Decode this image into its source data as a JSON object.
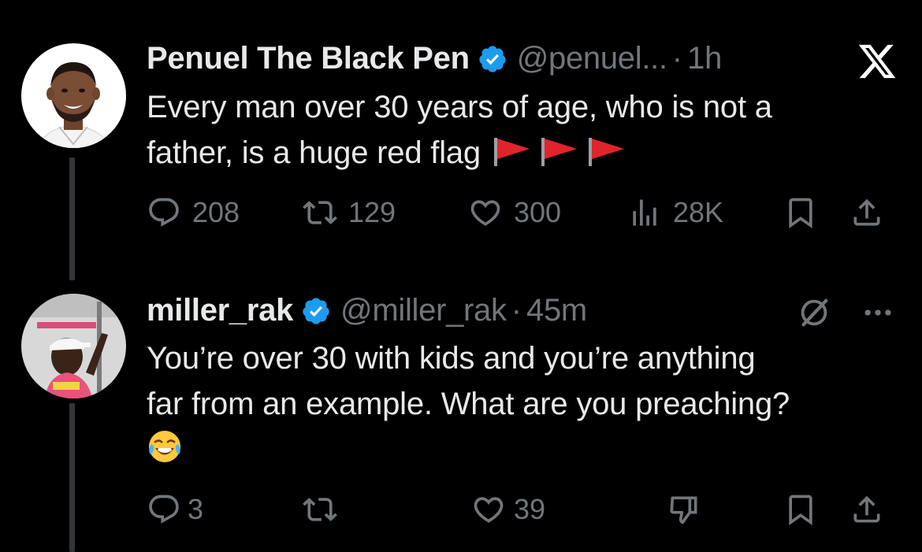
{
  "tweets": [
    {
      "name": "Penuel The Black Pen",
      "handle": "@penuel...",
      "time": "1h",
      "text_lines": [
        "Every man over 30 years of age, who is not a",
        "father, is a huge red flag"
      ],
      "emoji": [
        "red-flag",
        "red-flag",
        "red-flag"
      ],
      "stats": {
        "replies": "208",
        "reposts": "129",
        "likes": "300",
        "views": "28K"
      },
      "brand_icon": "x-logo-icon"
    },
    {
      "name": "miller_rak",
      "handle": "@miller_rak",
      "time": "45m",
      "text_lines": [
        "You’re over 30 with kids and you’re anything",
        "far from an example. What are you preaching?"
      ],
      "emoji": [
        "face-with-tears-of-joy"
      ],
      "stats": {
        "replies": "3",
        "reposts": "",
        "likes": "39"
      },
      "top_icons": [
        "grok-icon",
        "more-icon"
      ]
    }
  ],
  "colors": {
    "background": "#000000",
    "text": "#e7e9ea",
    "muted": "#71767b",
    "verified": "#1d9bf0",
    "thread_line": "#333639"
  },
  "separator": "·"
}
